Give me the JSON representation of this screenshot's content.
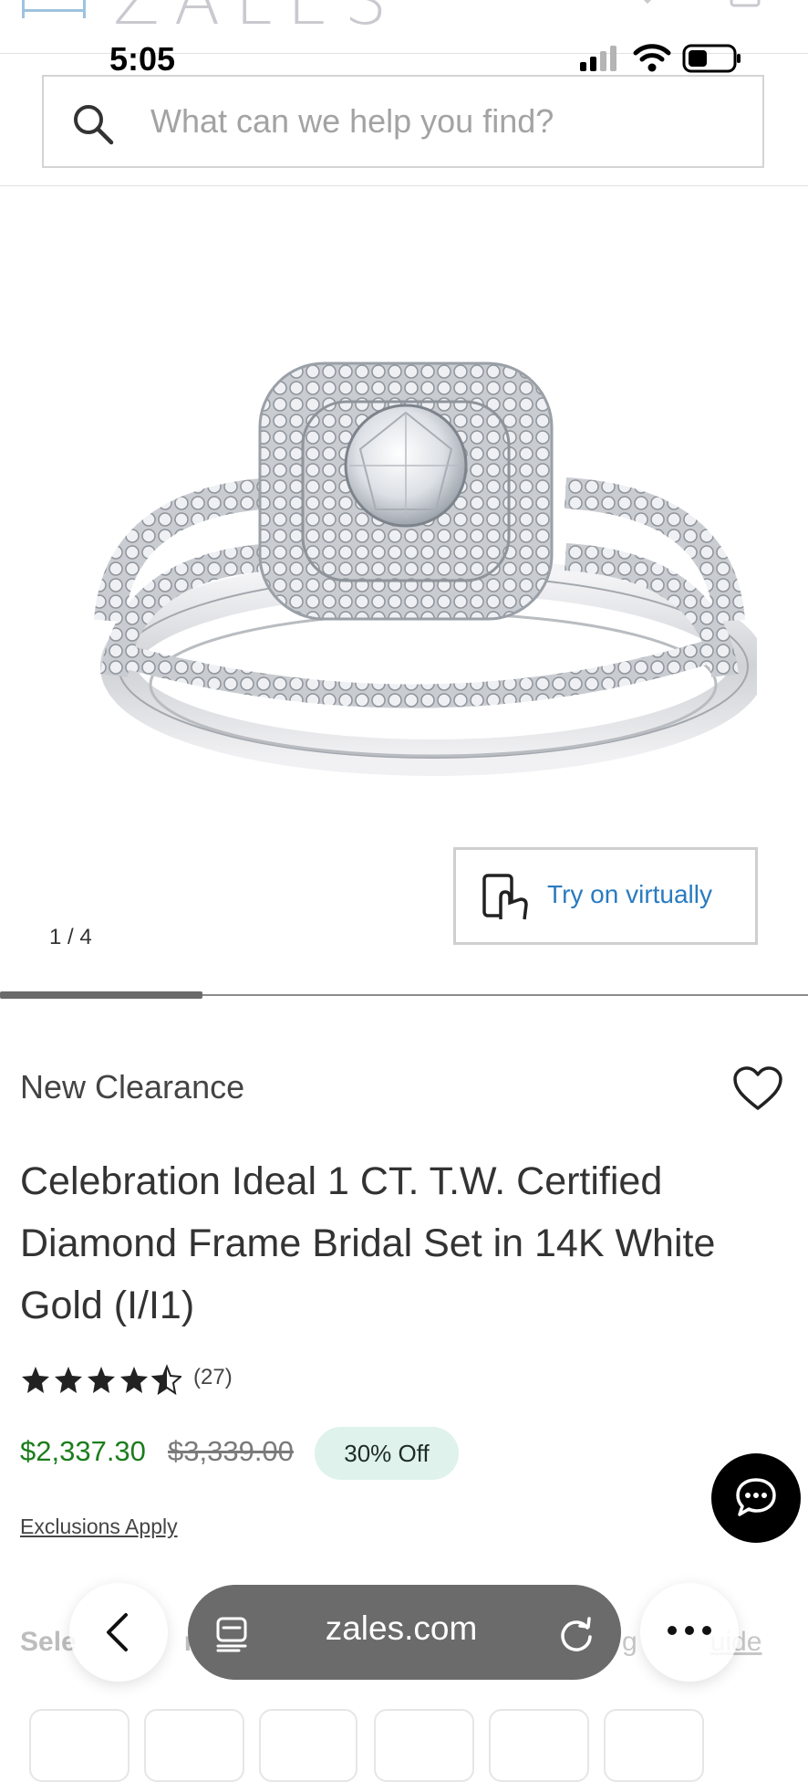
{
  "status_bar": {
    "time": "5:05"
  },
  "header": {
    "logo": "ZALES"
  },
  "search": {
    "placeholder": "What can we help you find?"
  },
  "gallery": {
    "try_on_label": "Try on virtually",
    "counter": "1 / 4",
    "current_slide": 1,
    "total_slides": 4
  },
  "product": {
    "badge": "New Clearance",
    "title": "Celebration Ideal 1 CT. T.W. Certified Diamond Frame Bridal Set in 14K White Gold (I/I1)",
    "rating": 4.5,
    "review_count": "(27)",
    "sale_price": "$2,337.30",
    "original_price": "$3,339.00",
    "discount": "30% Off",
    "exclusions": "Exclusions Apply"
  },
  "size_section": {
    "label": "Sele",
    "label_tail": "r",
    "guide_link": "g",
    "guide_tail": "uide"
  },
  "browser": {
    "url": "zales.com"
  },
  "colors": {
    "sale_price": "#1c7d1c",
    "link_blue": "#2a7bc0",
    "discount_bg": "#dff2ec",
    "url_bar": "#6b6b6b"
  },
  "icons": [
    "menu-icon",
    "heart-icon",
    "bag-icon",
    "search-icon",
    "hand-phone-icon",
    "heart-outline-icon",
    "star-icon",
    "chat-icon",
    "chevron-left-icon",
    "tabs-icon",
    "reload-icon",
    "more-icon"
  ]
}
